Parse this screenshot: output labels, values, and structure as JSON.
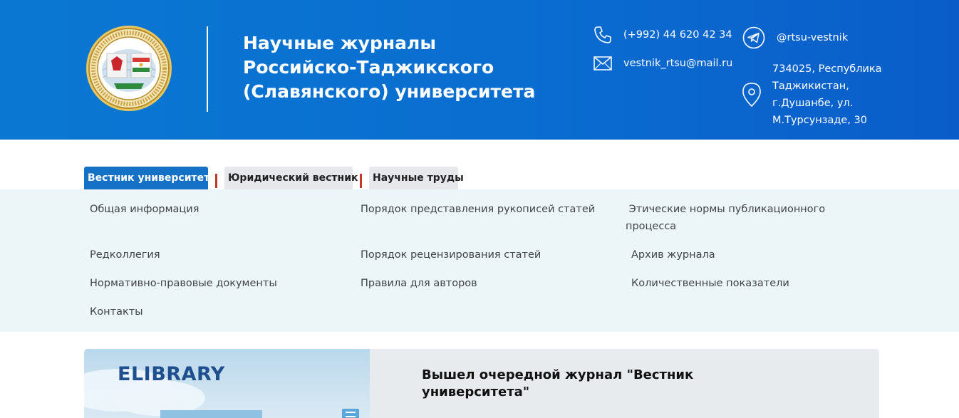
{
  "header": {
    "title": "Научные журналы Российско-Таджикского (Славянского) университета",
    "phone": "(+992) 44 620 42 34",
    "email": "vestnik_rtsu@mail.ru",
    "telegram": "@rtsu-vestnik",
    "address": "734025, Республика Таджикистан, г.Душанбе, ул. М.Турсунзаде, 30",
    "background_color": "#0a6dd0"
  },
  "tabs": [
    {
      "label": "Вестник университета",
      "active": true
    },
    {
      "label": "Юридический вестник",
      "active": false
    },
    {
      "label": "Научные труды",
      "active": false
    }
  ],
  "menu": {
    "col1": [
      "Общая информация",
      "Редколлегия",
      "Нормативно-правовые документы",
      "Контакты"
    ],
    "col2": [
      "Порядок представления рукописей статей",
      "Порядок рецензирования статей",
      "Правила для авторов"
    ],
    "col3": [
      " Этические нормы публикационного процесса",
      "Архив журнала",
      "Количественные показатели"
    ]
  },
  "news": {
    "image_logo_text": "ELIBRARY",
    "title": "Вышел очередной журнал \"Вестник университета\""
  },
  "colors": {
    "accent": "#1571c6",
    "tab_separator": "#c0392b",
    "menu_background": "#ecf5f8"
  },
  "icons": [
    "phone-icon",
    "mail-icon",
    "telegram-icon",
    "location-pin-icon",
    "university-seal-logo",
    "document-icon"
  ]
}
